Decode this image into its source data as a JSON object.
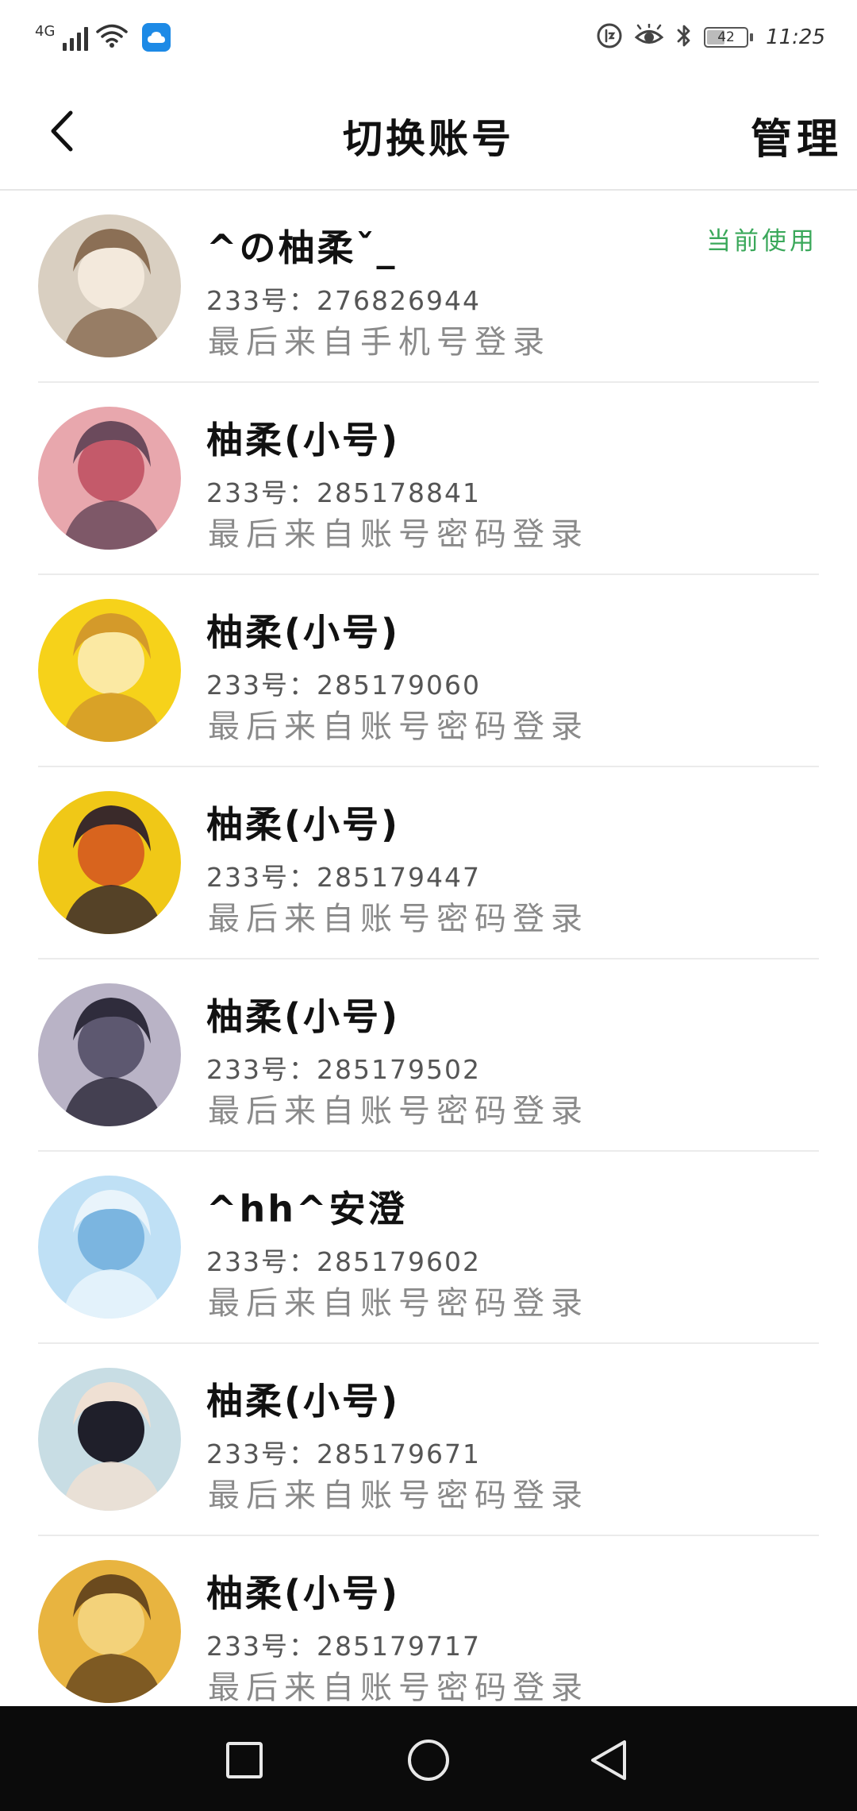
{
  "status_bar": {
    "network": "4G",
    "time": "11:25",
    "battery_level": "42",
    "icons": [
      "signal-icon",
      "wifi-icon",
      "weather-app-icon",
      "data-saver-icon",
      "eye-comfort-icon",
      "bluetooth-icon",
      "battery-icon"
    ]
  },
  "header": {
    "title": "切换账号",
    "manage_label": "管理",
    "back_icon": "chevron-left-icon"
  },
  "accounts": [
    {
      "name": "^の柚柔ˇ_",
      "id_line": "233号：276826944",
      "login_line": "最后来自手机号登录",
      "badge": "当前使用",
      "avatar_colors": [
        "#d9cfc1",
        "#f3e9dc",
        "#8b6f55"
      ]
    },
    {
      "name": "柚柔(小号)",
      "id_line": "233号：285178841",
      "login_line": "最后来自账号密码登录",
      "avatar_colors": [
        "#e8a7ad",
        "#c45a6a",
        "#6b4a5c"
      ]
    },
    {
      "name": "柚柔(小号)",
      "id_line": "233号：285179060",
      "login_line": "最后来自账号密码登录",
      "avatar_colors": [
        "#f6d21a",
        "#fbe9a3",
        "#d49a2a"
      ]
    },
    {
      "name": "柚柔(小号)",
      "id_line": "233号：285179447",
      "login_line": "最后来自账号密码登录",
      "avatar_colors": [
        "#f0c817",
        "#d8641e",
        "#3a2a2a"
      ]
    },
    {
      "name": "柚柔(小号)",
      "id_line": "233号：285179502",
      "login_line": "最后来自账号密码登录",
      "avatar_colors": [
        "#b9b3c6",
        "#5d5870",
        "#2f2c3c"
      ]
    },
    {
      "name": "^hh^安澄",
      "id_line": "233号：285179602",
      "login_line": "最后来自账号密码登录",
      "avatar_colors": [
        "#bfe0f5",
        "#7bb5e0",
        "#e9f4fb"
      ]
    },
    {
      "name": "柚柔(小号)",
      "id_line": "233号：285179671",
      "login_line": "最后来自账号密码登录",
      "avatar_colors": [
        "#c8dde4",
        "#1f1f2a",
        "#efe0d3"
      ]
    },
    {
      "name": "柚柔(小号)",
      "id_line": "233号：285179717",
      "login_line": "最后来自账号密码登录",
      "avatar_colors": [
        "#e8b440",
        "#f3d27a",
        "#6b4a1e"
      ]
    }
  ],
  "nav_bar": {
    "buttons": [
      "recent-apps-icon",
      "home-icon",
      "back-triangle-icon"
    ]
  },
  "colors": {
    "accent_green": "#3aa85a",
    "secondary_text": "#8a8a8a",
    "nav_background": "#0b0b0b"
  }
}
